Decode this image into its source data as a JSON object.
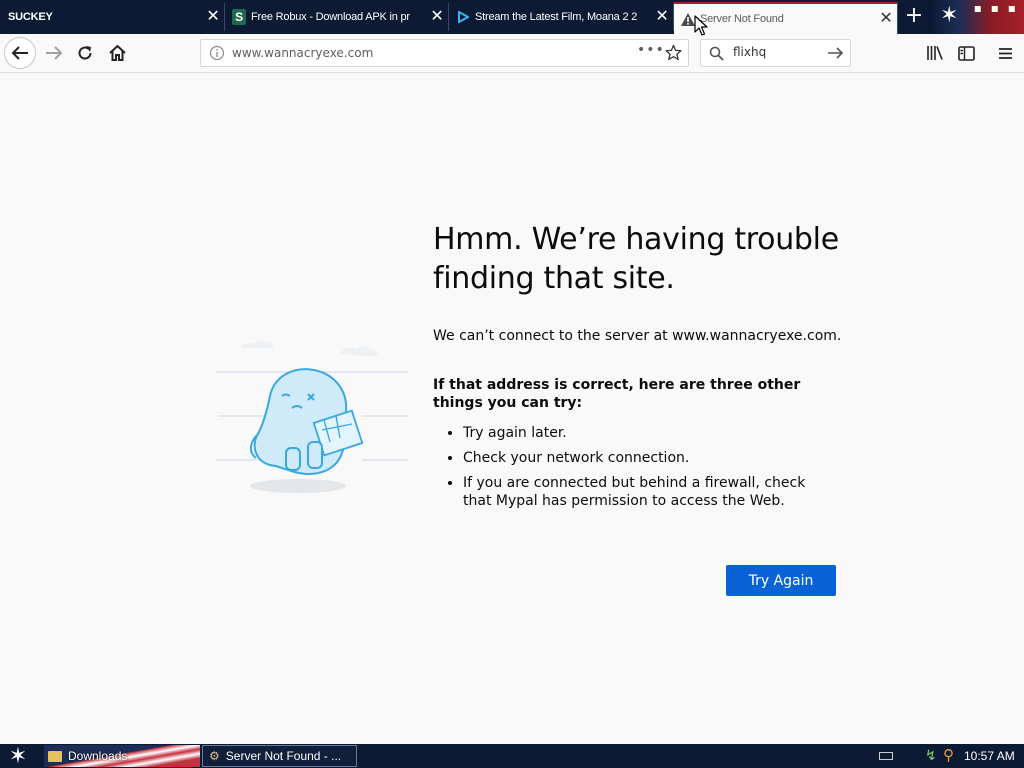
{
  "tabs": [
    {
      "label": "SUCKEY",
      "close": "✕"
    },
    {
      "label": "Free Robux - Download APK in pr",
      "icon": "S",
      "close": "✕"
    },
    {
      "label": "Stream the Latest Film, Moana 2 2",
      "close": "✕"
    },
    {
      "label": "Server Not Found",
      "close": "✕"
    }
  ],
  "new_tab": "+",
  "url_bar": {
    "value": "www.wannacryexe.com",
    "page_actions": "•••"
  },
  "search_bar": {
    "value": "flixhq"
  },
  "error_page": {
    "title": "Hmm. We’re having trouble finding that site.",
    "description": "We can’t connect to the server at www.wannacryexe.com.",
    "tips_heading": "If that address is correct, here are three other things you can try:",
    "tips": [
      "Try again later.",
      "Check your network connection.",
      "If you are connected but behind a firewall, check that Mypal has permission to access the Web."
    ],
    "button": "Try Again"
  },
  "taskbar": {
    "items": [
      "Downloads",
      "Server Not Found - ..."
    ],
    "clock": "10:57 AM"
  },
  "colors": {
    "accent": "#0a63d6",
    "tabstrip": "#0c1b33",
    "page_bg": "#f9f9fa"
  }
}
